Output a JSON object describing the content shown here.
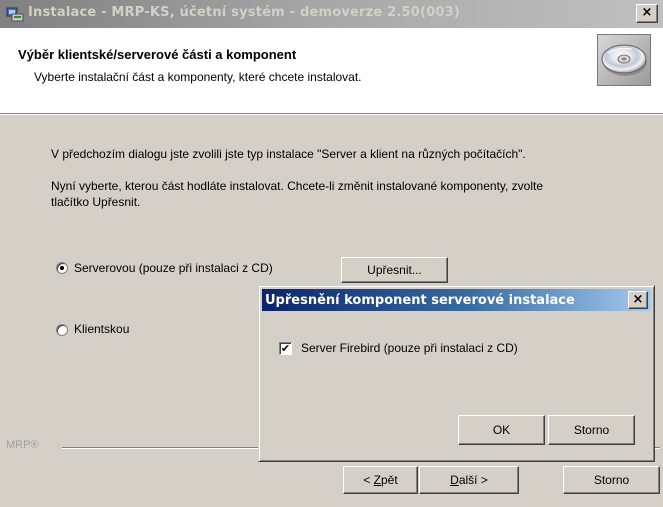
{
  "window": {
    "title": "Instalace - MRP-KS, účetní systém - demoverze 2.50(003)",
    "close_glyph": "×"
  },
  "header": {
    "title": "Výběr klientské/serverové části a komponent",
    "subtitle": "Vyberte instalační část a komponenty, které chcete instalovat."
  },
  "body": {
    "paragraph1": "V předchozím dialogu jste zvolili jste typ instalace \"Server a klient na různých počítačích\".",
    "paragraph2_line1": "Nyní vyberte, kterou část hodláte instalovat. Chcete-li změnit instalované komponenty, zvolte",
    "paragraph2_line2": "tlačítko Upřesnit."
  },
  "options": {
    "server_label": "Serverovou (pouze při instalaci z CD)",
    "server_selected": true,
    "client_label": "Klientskou",
    "client_selected": false,
    "details_button": "Upřesnit..."
  },
  "footer": {
    "brand": "MRP®",
    "back_prefix": "< ",
    "back_accel": "Z",
    "back_rest": "pět",
    "next_accel": "D",
    "next_rest": "alší >",
    "cancel": "Storno"
  },
  "dialog": {
    "title": "Upřesnění komponent serverové instalace",
    "close_glyph": "×",
    "checkbox_label": "Server Firebird (pouze při instalaci z CD)",
    "checkbox_checked": true,
    "check_glyph": "✔",
    "ok": "OK",
    "cancel": "Storno"
  },
  "colors": {
    "face": "#d4d0c8",
    "active_title": "#0a246a",
    "inactive_title": "#808080"
  },
  "icons": [
    "installer-app-icon",
    "cd-disc-icon",
    "close-icon",
    "check-icon"
  ]
}
